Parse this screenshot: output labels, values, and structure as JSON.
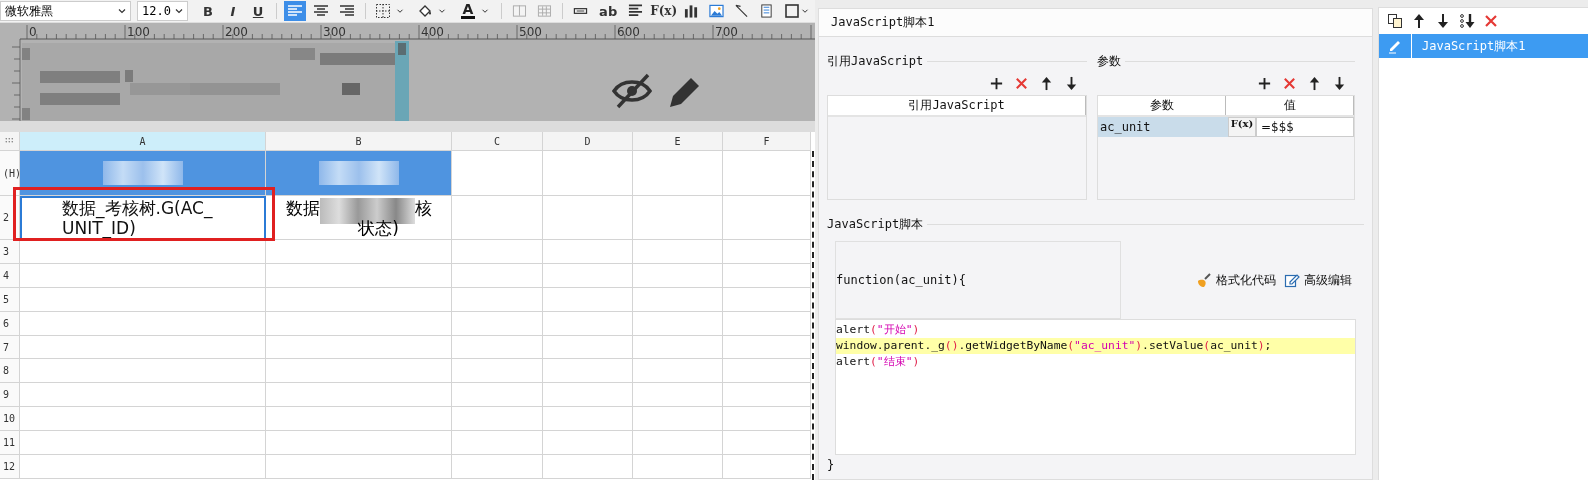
{
  "toolbar": {
    "font": "微软雅黑",
    "size": "12.0",
    "style_buttons": [
      "B",
      "I",
      "U"
    ],
    "align_buttons": [
      {
        "selected": true
      },
      {
        "selected": false
      },
      {
        "selected": false
      }
    ],
    "color_button": "A",
    "insert_buttons": [
      "ab",
      "F(x)"
    ]
  },
  "ruler": {
    "labels": [
      "0",
      "100",
      "200",
      "300",
      "400",
      "500",
      "600",
      "700"
    ]
  },
  "sheet": {
    "columns": [
      {
        "label": "A",
        "selected": true
      },
      {
        "label": "B",
        "selected": false
      },
      {
        "label": "C",
        "selected": false
      },
      {
        "label": "D",
        "selected": false
      },
      {
        "label": "E",
        "selected": false
      },
      {
        "label": "F",
        "selected": false
      }
    ],
    "rows": [
      {
        "label": "(H)",
        "cells": [
          {
            "kind": "blurred"
          },
          {
            "kind": "blurred"
          }
        ]
      },
      {
        "label": "2",
        "cells": [
          {
            "kind": "text",
            "text": "数据_考核树.G(AC_UNIT_ID)",
            "selected": true
          },
          {
            "kind": "redacted",
            "parts": [
              "数据",
              "核",
              "状态)"
            ],
            "selected": false
          }
        ]
      },
      {
        "label": "3"
      },
      {
        "label": "4"
      },
      {
        "label": "5"
      },
      {
        "label": "6"
      },
      {
        "label": "7"
      },
      {
        "label": "8"
      },
      {
        "label": "9"
      },
      {
        "label": "10"
      },
      {
        "label": "11"
      },
      {
        "label": "12"
      }
    ]
  },
  "dialog": {
    "title": "JavaScript脚本1",
    "imports": {
      "label": "引用JavaScript",
      "column": "引用JavaScript"
    },
    "params": {
      "label": "参数",
      "columns": [
        "参数",
        "值"
      ],
      "rows": [
        {
          "name": "ac_unit",
          "formula_button": "F(x)",
          "value": "=$$$"
        }
      ]
    },
    "script": {
      "label": "JavaScript脚本",
      "header": "function(ac_unit){",
      "actions": [
        "格式化代码",
        "高级编辑"
      ],
      "lines": [
        {
          "highlighted": false,
          "tokens": [
            {
              "kind": "plain",
              "text": "alert"
            },
            {
              "kind": "paren",
              "text": "("
            },
            {
              "kind": "string",
              "text": "\"开始\""
            },
            {
              "kind": "paren",
              "text": ")"
            }
          ]
        },
        {
          "highlighted": true,
          "tokens": [
            {
              "kind": "plain",
              "text": "window.parent._g"
            },
            {
              "kind": "paren",
              "text": "()"
            },
            {
              "kind": "plain",
              "text": ".getWidgetByName"
            },
            {
              "kind": "paren",
              "text": "("
            },
            {
              "kind": "string",
              "text": "\"ac_unit\""
            },
            {
              "kind": "paren",
              "text": ")"
            },
            {
              "kind": "plain",
              "text": ".setValue"
            },
            {
              "kind": "paren",
              "text": "("
            },
            {
              "kind": "plain",
              "text": "ac_unit"
            },
            {
              "kind": "paren",
              "text": ")"
            },
            {
              "kind": "plain",
              "text": ";"
            }
          ]
        },
        {
          "highlighted": false,
          "tokens": [
            {
              "kind": "plain",
              "text": "alert"
            },
            {
              "kind": "paren",
              "text": "("
            },
            {
              "kind": "string",
              "text": "\"结束\""
            },
            {
              "kind": "paren",
              "text": ")"
            }
          ]
        }
      ],
      "footer": "}"
    }
  },
  "list": {
    "items": [
      {
        "label": "JavaScript脚本1",
        "selected": true
      }
    ]
  }
}
